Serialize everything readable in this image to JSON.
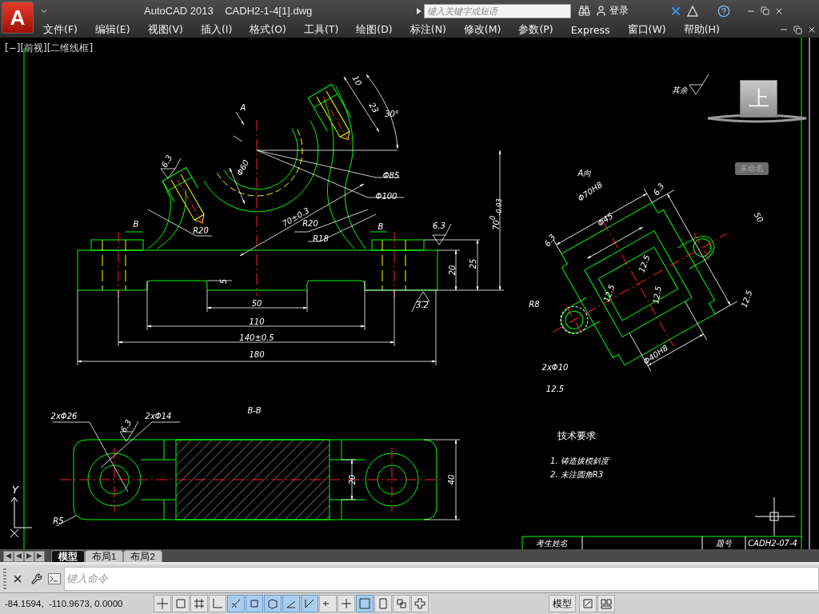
{
  "app_button": {
    "letter": "A"
  },
  "title_bar": {
    "product": "AutoCAD 2013",
    "file": "CADH2-1-4[1].dwg",
    "search": {
      "placeholder": "键入关键字或短语"
    },
    "sign_in": "登录"
  },
  "menu": [
    "文件(F)",
    "编辑(E)",
    "视图(V)",
    "插入(I)",
    "格式(O)",
    "工具(T)",
    "绘图(D)",
    "标注(N)",
    "修改(M)",
    "参数(P)",
    "Express",
    "窗口(W)",
    "帮助(H)"
  ],
  "viewport_label": "[−][前视][二维线框]",
  "view_cube": {
    "face": "上",
    "view_name": "未命名"
  },
  "roughness_note": "其余",
  "front_view": {
    "labels": [
      "10",
      "23",
      "A",
      "30°",
      "6.3",
      "Φ60",
      "Φ85",
      "Φ100",
      "70$^{0}$$_{-0.03}$",
      "70±0.3",
      "B",
      "R20",
      "R20",
      "B",
      "6.3",
      "R18",
      "25",
      "20",
      "5",
      "50",
      "3.2",
      "110",
      "140±0.5",
      "180"
    ]
  },
  "side_view": {
    "title": "A向",
    "labels": [
      "6.3",
      "Φ70H8",
      "50",
      "Φ45",
      "6.3",
      "12.5",
      "12.5",
      "12.5",
      "12.5",
      "R8",
      "Φ40H8",
      "2xΦ10",
      "12.5"
    ]
  },
  "section_view": {
    "title": "B-B",
    "labels": [
      "2xΦ26",
      "2xΦ14",
      "6.3",
      "20",
      "40",
      "R5"
    ]
  },
  "technical_requirements": {
    "title": "技术要求",
    "items": [
      "1. 铸造拔模斜度",
      "2. 未注圆角R3"
    ]
  },
  "title_block": [
    "考生姓名",
    "题号",
    "CADH2-07-4"
  ],
  "ucs": {
    "axis": "Y"
  },
  "layout_tabs": [
    {
      "label": "模型",
      "selected": true
    },
    {
      "label": "布局1",
      "selected": false
    },
    {
      "label": "布局2",
      "selected": false
    }
  ],
  "command_line": {
    "placeholder": "键入命令"
  },
  "status_bar": {
    "coordinates": "-84.1594,  -110.9673, 0.0000",
    "model": "模型",
    "toggles": [
      {
        "on": false
      },
      {
        "on": false
      },
      {
        "on": false
      },
      {
        "on": false
      },
      {
        "on": true
      },
      {
        "on": true
      },
      {
        "on": true
      },
      {
        "on": true
      },
      {
        "on": true
      },
      {
        "on": false
      },
      {
        "on": false
      },
      {
        "on": true
      },
      {
        "on": false
      },
      {
        "on": false
      },
      {
        "on": false
      }
    ]
  }
}
